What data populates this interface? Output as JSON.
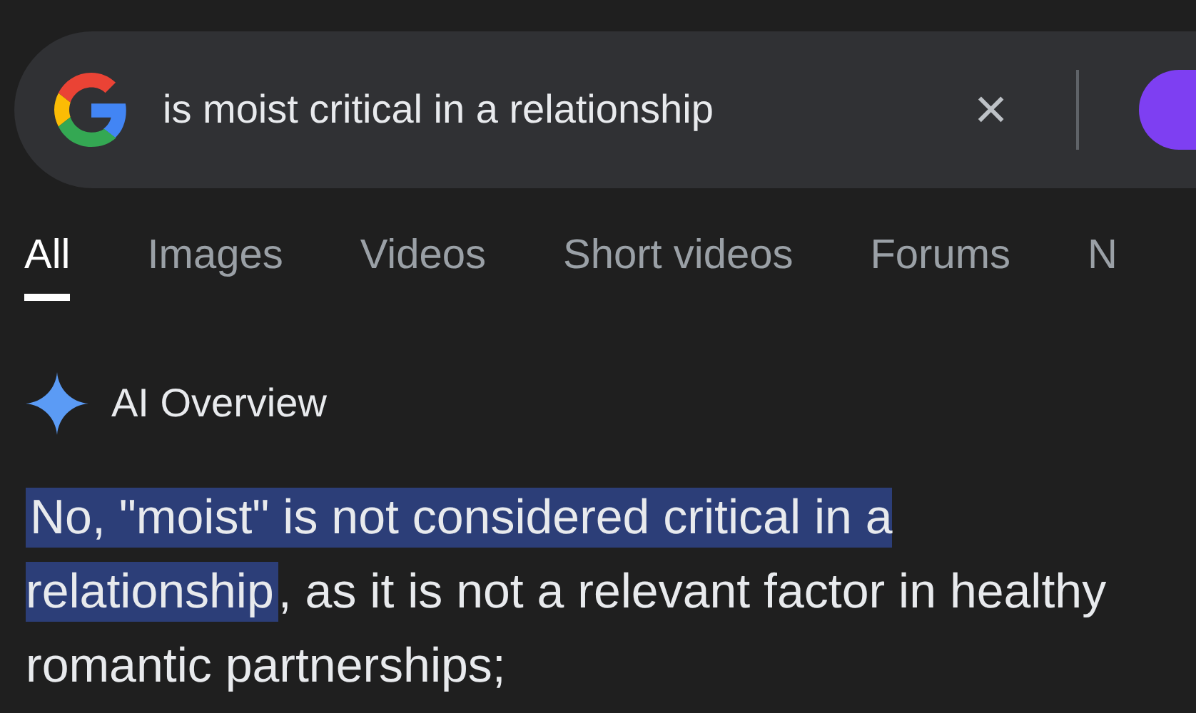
{
  "search": {
    "query": "is moist critical in a relationship",
    "clear": "×"
  },
  "tabs": [
    {
      "label": "All",
      "selected": true
    },
    {
      "label": "Images",
      "selected": false
    },
    {
      "label": "Videos",
      "selected": false
    },
    {
      "label": "Short videos",
      "selected": false
    },
    {
      "label": "Forums",
      "selected": false
    },
    {
      "label": "N",
      "selected": false
    }
  ],
  "ai_overview": {
    "title": "AI Overview",
    "highlighted": "No, \"moist\" is not considered critical in a relationship",
    "rest": ", as it is not a relevant factor in healthy romantic partnerships;"
  }
}
